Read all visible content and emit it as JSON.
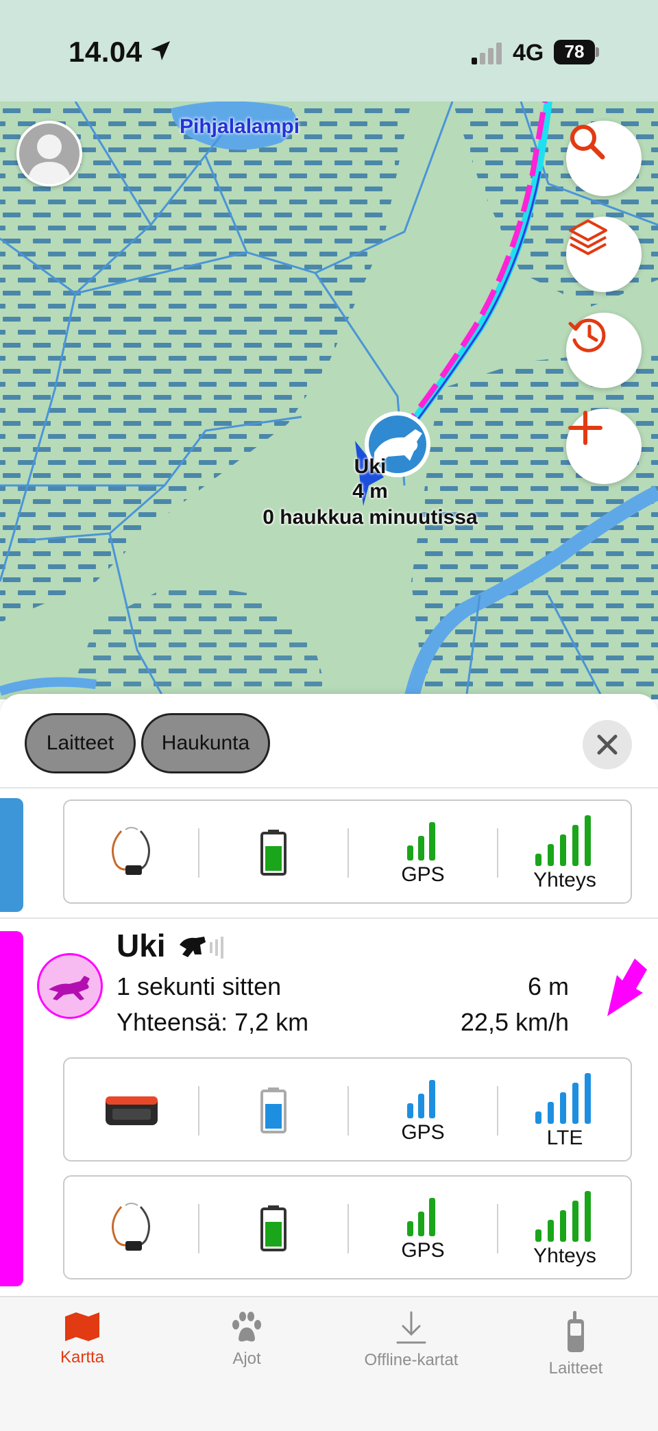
{
  "status_bar": {
    "time": "14.04",
    "network": "4G",
    "battery": "78"
  },
  "map": {
    "lake_name": "Pihjalalampi",
    "dog_marker": {
      "name": "Uki",
      "distance": "4 m",
      "barks": "0  haukkua minuutissa"
    },
    "buttons": [
      "search-icon",
      "layers-icon",
      "history-icon",
      "plus-icon"
    ]
  },
  "sheet": {
    "chips": [
      "Laitteet",
      "Haukunta"
    ],
    "top_device": {
      "gps_label": "GPS",
      "link_label": "Yhteys",
      "battery_color": "#1aa51a"
    },
    "dog": {
      "name": "Uki",
      "last_seen": "1 sekunti sitten",
      "distance": "6 m",
      "total": "Yhteensä: 7,2 km",
      "speed": "22,5 km/h",
      "accent": "#ff00ff"
    },
    "devices": [
      {
        "gps_label": "GPS",
        "link_label": "LTE",
        "battery_color": "#1e8fe0",
        "signal_color": "#1e8fe0"
      },
      {
        "gps_label": "GPS",
        "link_label": "Yhteys",
        "battery_color": "#1aa51a",
        "signal_color": "#1aa51a"
      }
    ]
  },
  "tabs": [
    {
      "label": "Kartta",
      "icon": "map-icon",
      "active": true
    },
    {
      "label": "Ajot",
      "icon": "paw-icon",
      "active": false
    },
    {
      "label": "Offline-kartat",
      "icon": "download-icon",
      "active": false
    },
    {
      "label": "Laitteet",
      "icon": "handheld-device-icon",
      "active": false
    }
  ],
  "colors": {
    "accent": "#e23a12",
    "map_water": "#5fa8e8",
    "signal_green": "#1aa51a",
    "signal_blue": "#1e8fe0"
  }
}
